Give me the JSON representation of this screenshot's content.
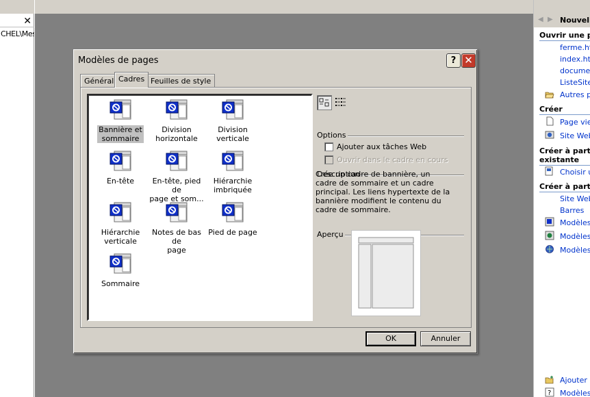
{
  "left_panel": {
    "close_glyph": "✕",
    "path_text": "CHEL\\Mes"
  },
  "task_pane": {
    "title": "Nouvelle",
    "sections": {
      "open": "Ouvrir une pa",
      "create": "Créer",
      "from_existing_1": "Créer à partir",
      "from_existing_2": "existante",
      "from_template": "Créer à partir"
    },
    "links": {
      "open_1": "ferme.htm",
      "open_2": "index.htm",
      "open_3": "document",
      "open_4": "ListeSites",
      "open_more": "Autres pa",
      "create_page": "Page vier",
      "create_site": "Site Web",
      "choose": "Choisir ur",
      "tmpl_site": "Site Web",
      "tmpl_bars": "Barres",
      "tmpl_models_1": "Modèles d",
      "tmpl_models_2": "Modèles d",
      "tmpl_models_3": "Modèles s",
      "add": "Ajouter u",
      "help": "Modèles d"
    }
  },
  "dialog": {
    "title": "Modèles de pages",
    "help_glyph": "?",
    "close_glyph": "✕",
    "tabs": {
      "general": "Général",
      "frames": "Cadres",
      "styles": "Feuilles de style"
    },
    "templates": [
      {
        "line1": "Bannière et",
        "line2": "sommaire",
        "selected": true
      },
      {
        "line1": "Division",
        "line2": "horizontale"
      },
      {
        "line1": "Division verticale",
        "line2": ""
      },
      {
        "line1": "En-tête",
        "line2": ""
      },
      {
        "line1": "En-tête, pied de",
        "line2": "page et som..."
      },
      {
        "line1": "Hiérarchie",
        "line2": "imbriquée"
      },
      {
        "line1": "Hiérarchie",
        "line2": "verticale"
      },
      {
        "line1": "Notes de bas de",
        "line2": "page"
      },
      {
        "line1": "Pied de page",
        "line2": ""
      },
      {
        "line1": "Sommaire",
        "line2": ""
      }
    ],
    "options_label": "Options",
    "option_add_tasks": "Ajouter aux tâches Web",
    "option_open_frame": "Ouvrir dans le cadre en cours",
    "description_label": "Description",
    "description_text": "Crée un cadre de bannière, un cadre de sommaire et un cadre principal. Les liens hypertexte de la bannière modifient le contenu du cadre de sommaire.",
    "preview_label": "Aperçu",
    "ok_label": "OK",
    "cancel_label": "Annuler"
  },
  "colors": {
    "icon_blue": "#1030c8",
    "link_blue": "#0033cc",
    "dialog_face": "#d4d0c8",
    "workspace": "#808080"
  }
}
